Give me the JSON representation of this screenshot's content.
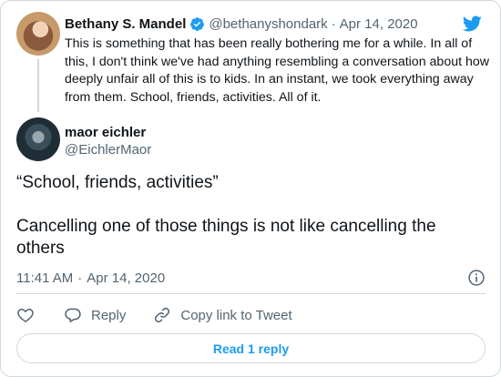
{
  "parent_tweet": {
    "author_name": "Bethany S. Mandel",
    "handle": "@bethanyshondark",
    "separator": "·",
    "date": "Apr 14, 2020",
    "text": "This is something that has been really bothering me for a while. In all of this, I don't think we've had anything resembling a conversation about how deeply unfair all of this is to kids. In an instant, we took everything away from them. School, friends, activities. All of it."
  },
  "tweet": {
    "author_name": "maor eichler",
    "handle": "@EichlerMaor",
    "text_line1": "“School, friends, activities”",
    "text_line2": "Cancelling one of those things is not like cancelling the others",
    "time": "11:41 AM",
    "separator": "·",
    "date": "Apr 14, 2020"
  },
  "actions": {
    "reply_label": "Reply",
    "copy_link_label": "Copy link to Tweet"
  },
  "read_replies_label": "Read 1 reply",
  "colors": {
    "accent": "#1d9bf0",
    "text_primary": "#0f1419",
    "text_secondary": "#536471",
    "border": "#cfd9de"
  },
  "icons": [
    "verified-badge-icon",
    "twitter-bird-icon",
    "info-icon",
    "heart-icon",
    "reply-bubble-icon",
    "link-icon"
  ]
}
